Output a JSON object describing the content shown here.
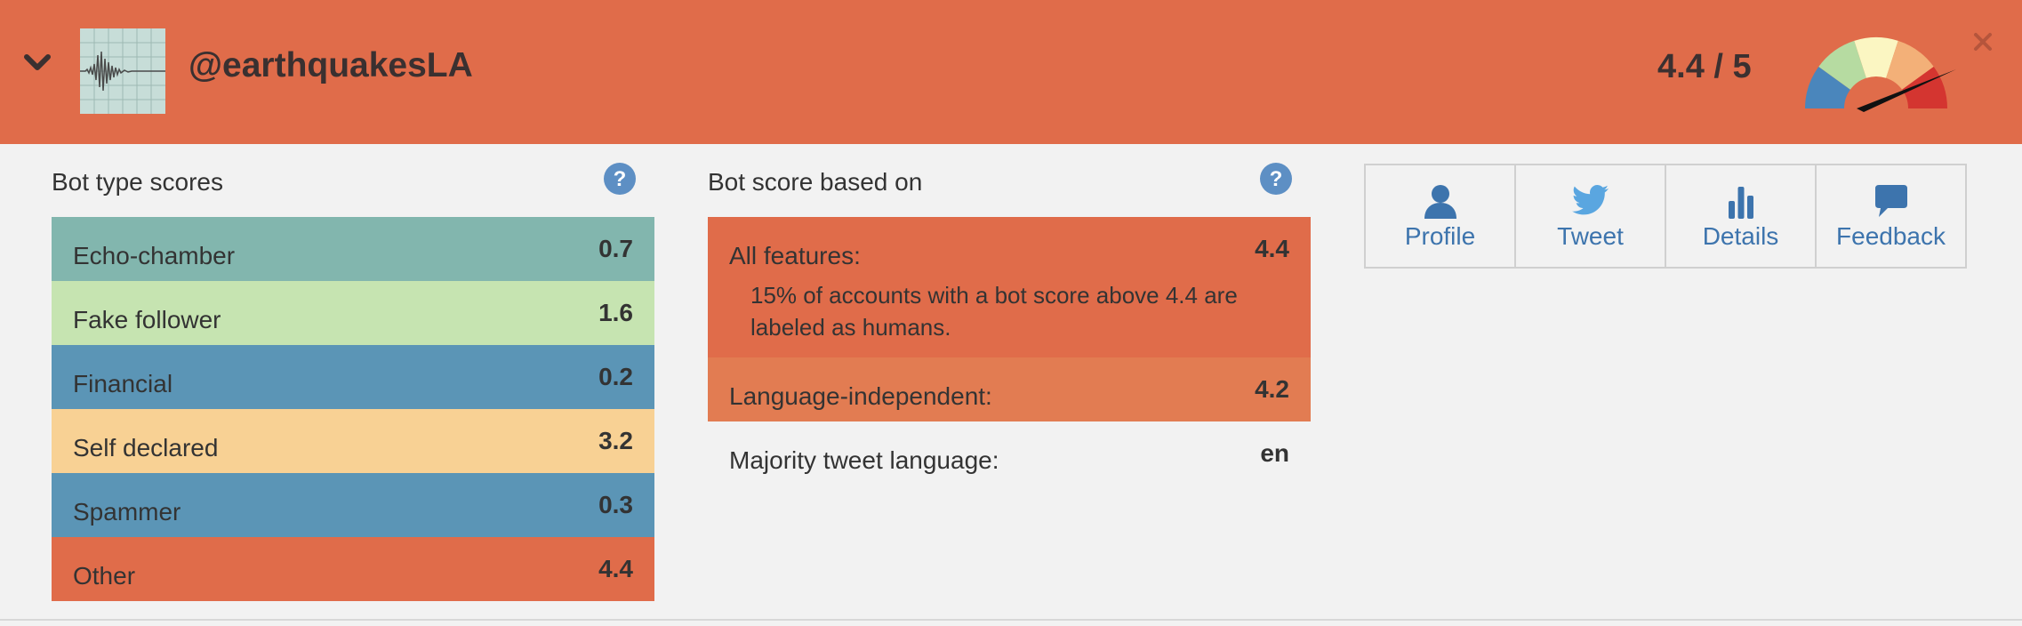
{
  "header": {
    "handle": "@earthquakesLA",
    "score": "4.4 / 5",
    "colors": {
      "background": "#e06c4a"
    }
  },
  "bot_type": {
    "title": "Bot type scores",
    "rows": [
      {
        "label": "Echo-chamber",
        "value": "0.7",
        "color": "#82b6ae"
      },
      {
        "label": "Fake follower",
        "value": "1.6",
        "color": "#c6e4b1"
      },
      {
        "label": "Financial",
        "value": "0.2",
        "color": "#5b95b6"
      },
      {
        "label": "Self declared",
        "value": "3.2",
        "color": "#f8d194"
      },
      {
        "label": "Spammer",
        "value": "0.3",
        "color": "#5b95b6"
      },
      {
        "label": "Other",
        "value": "4.4",
        "color": "#e06c4a"
      }
    ]
  },
  "bot_score": {
    "title": "Bot score based on",
    "all_features": {
      "label": "All features:",
      "value": "4.4",
      "note": "15% of accounts with a bot score above 4.4 are labeled as humans.",
      "color": "#e06c4a"
    },
    "language_independent": {
      "label": "Language-independent:",
      "value": "4.2",
      "color": "#e27c52"
    },
    "majority_language": {
      "label": "Majority tweet language:",
      "value": "en"
    }
  },
  "actions": {
    "profile": "Profile",
    "tweet": "Tweet",
    "details": "Details",
    "feedback": "Feedback"
  },
  "icons": {
    "collapse": "chevron-down-icon",
    "close": "close-icon",
    "help": "question-icon",
    "gauge": "gauge-meter-icon"
  }
}
